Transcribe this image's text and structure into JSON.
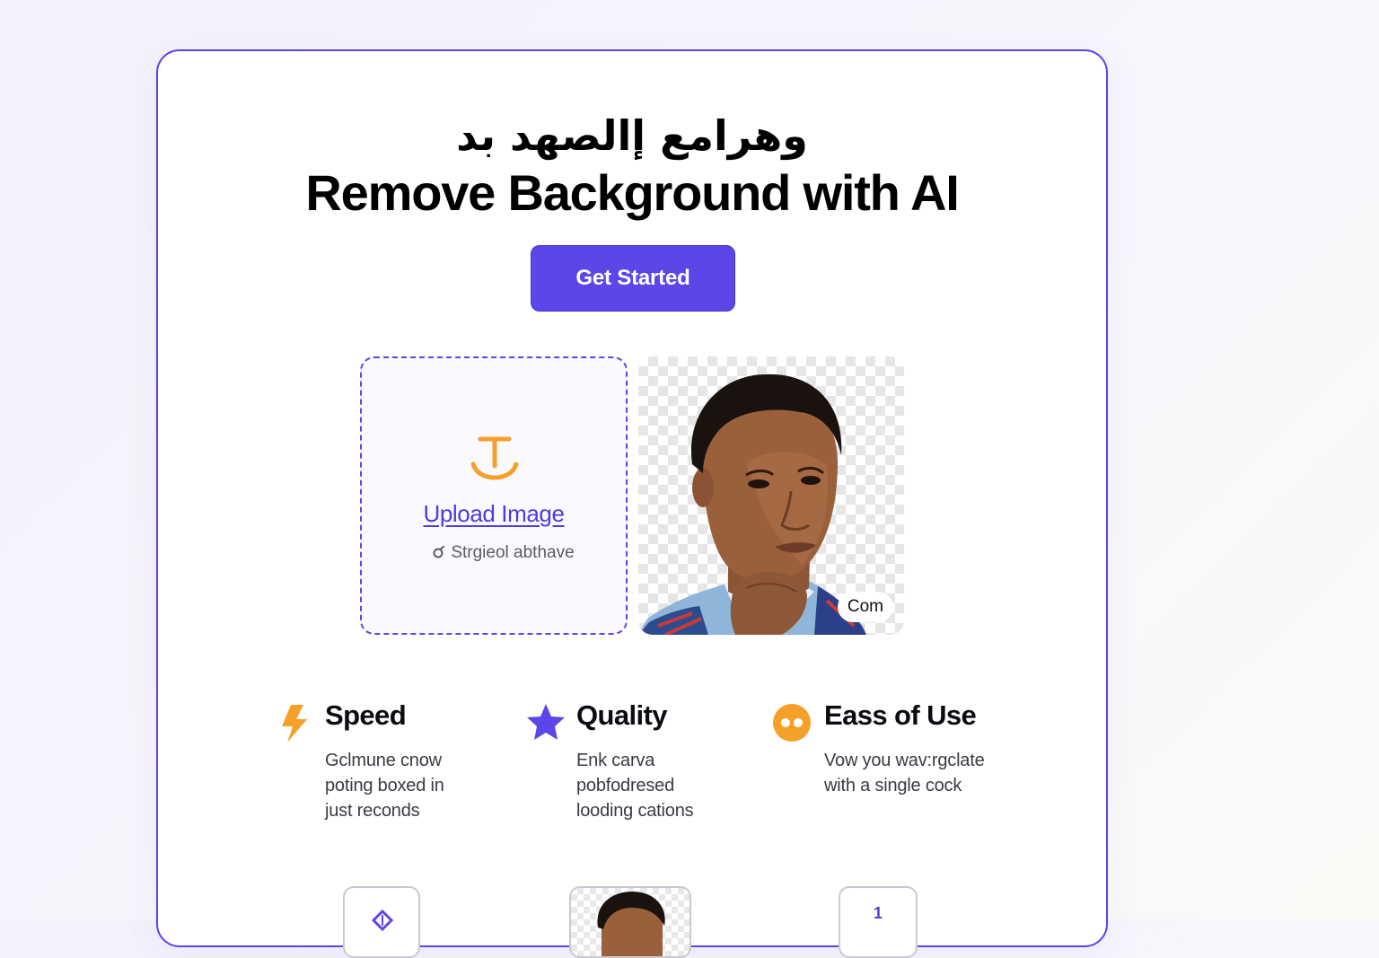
{
  "hero": {
    "title_arabic": "وهرامع إالصهد بد",
    "title": "Remove Background with AI",
    "cta_label": "Get Started"
  },
  "upload": {
    "icon": "upload-arrow-icon",
    "link_label": "Upload Image",
    "sub_label": "Strgieol abthave"
  },
  "preview": {
    "badge": "Com"
  },
  "features": [
    {
      "icon": "lightning-icon",
      "title": "Speed",
      "desc": "Gclmune cnow\npoting boxed in\njust reconds"
    },
    {
      "icon": "star-icon",
      "title": "Quality",
      "desc": "Enk carva\npobfodresed\nlooding cations"
    },
    {
      "icon": "smiley-icon",
      "title": "Eass of Use",
      "desc": "Vow you wav:rgclate\nwith a single cock"
    }
  ],
  "thumbnails": {
    "third_label": "1"
  },
  "colors": {
    "accent": "#5b47e8",
    "orange": "#f5a029",
    "background": "#f5f3fb"
  }
}
